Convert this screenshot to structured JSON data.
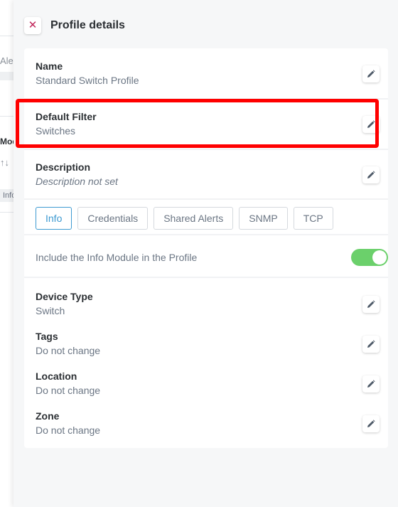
{
  "background_page": {
    "fragment_1": "Aler",
    "fragment_2": "Mod",
    "sort_glyph": "↑↓",
    "chip": "Info"
  },
  "drawer": {
    "close_icon": "✕",
    "title": "Profile details"
  },
  "fields": {
    "name": {
      "label": "Name",
      "value": "Standard Switch Profile"
    },
    "default_filter": {
      "label": "Default Filter",
      "value": "Switches"
    },
    "description": {
      "label": "Description",
      "value": "Description not set"
    }
  },
  "tabs": [
    "Info",
    "Credentials",
    "Shared Alerts",
    "SNMP",
    "TCP"
  ],
  "active_tab": "Info",
  "info_module": {
    "label": "Include the Info Module in the Profile",
    "enabled": true
  },
  "info_fields": {
    "device_type": {
      "label": "Device Type",
      "value": "Switch"
    },
    "tags": {
      "label": "Tags",
      "value": "Do not change"
    },
    "location": {
      "label": "Location",
      "value": "Do not change"
    },
    "zone": {
      "label": "Zone",
      "value": "Do not change"
    }
  },
  "colors": {
    "highlight": "#ff0000",
    "accent": "#3d9ad1",
    "toggle_on": "#6bd06b",
    "close": "#c0265a"
  },
  "icons": {
    "close": "close-icon",
    "edit": "pencil-icon"
  }
}
